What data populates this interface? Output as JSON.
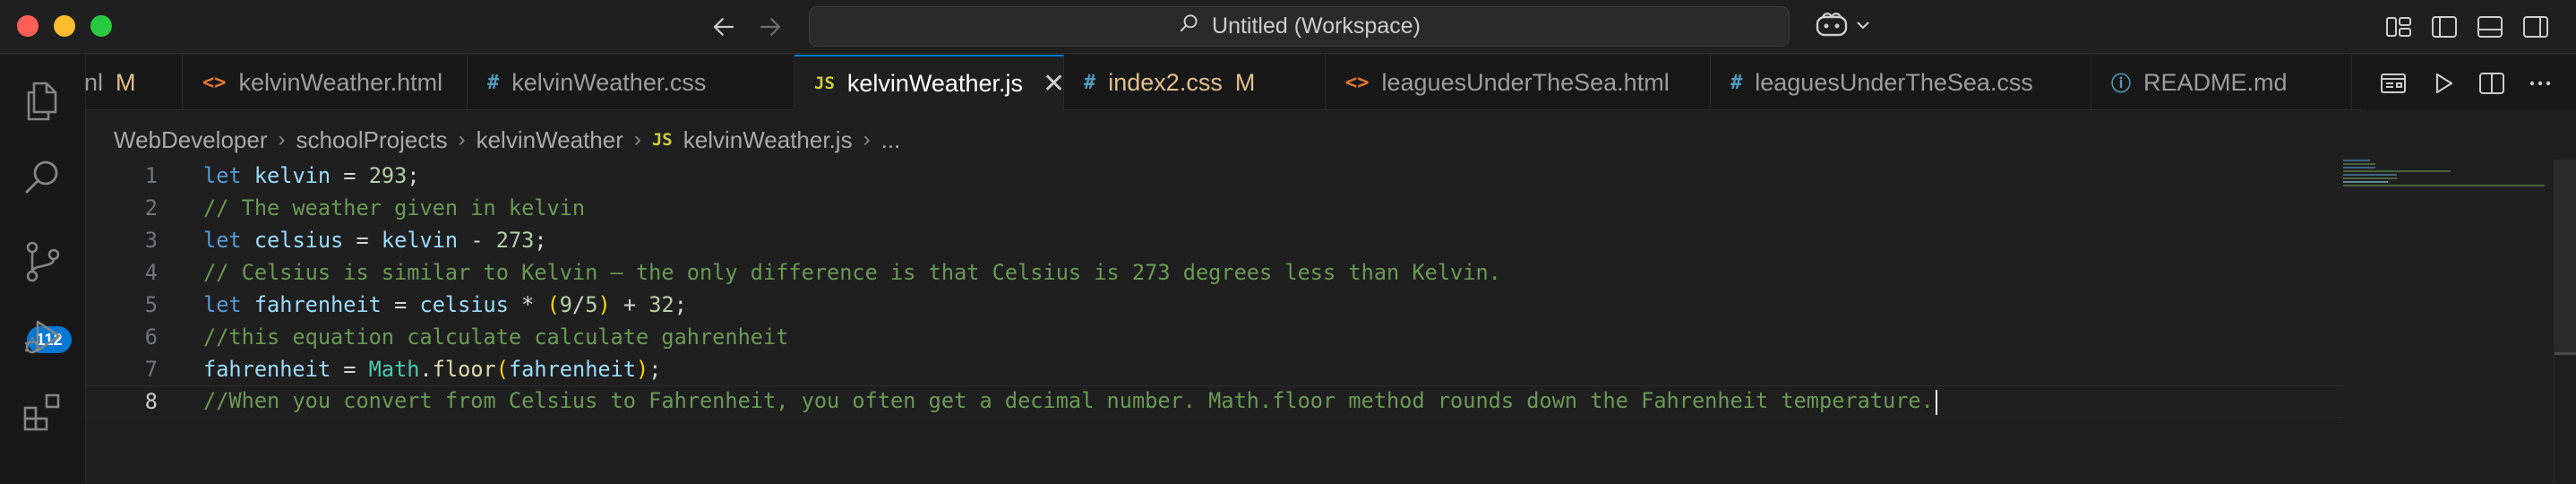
{
  "titlebar": {
    "search_text": "Untitled (Workspace)",
    "icons": [
      "back-arrow-icon",
      "forward-arrow-icon",
      "search-icon",
      "copilot-icon",
      "chevron-down-icon",
      "customize-layout-icon",
      "toggle-primary-sidebar-icon",
      "toggle-panel-icon",
      "toggle-secondary-sidebar-icon"
    ]
  },
  "activitybar": {
    "items": [
      "explorer-icon",
      "search-icon",
      "source-control-icon",
      "run-debug-icon",
      "extensions-icon"
    ],
    "source_control_badge": "112"
  },
  "tabs": [
    {
      "label": "nl",
      "icon": "",
      "modified": "M",
      "active": false
    },
    {
      "label": "kelvinWeather.html",
      "icon": "<>",
      "modified": "",
      "active": false
    },
    {
      "label": "kelvinWeather.css",
      "icon": "#",
      "modified": "",
      "active": false
    },
    {
      "label": "kelvinWeather.js",
      "icon": "JS",
      "modified": "",
      "active": true
    },
    {
      "label": "index2.css",
      "icon": "#",
      "modified": "M",
      "active": false
    },
    {
      "label": "leaguesUnderTheSea.html",
      "icon": "<>",
      "modified": "",
      "active": false
    },
    {
      "label": "leaguesUnderTheSea.css",
      "icon": "#",
      "modified": "",
      "active": false
    },
    {
      "label": "README.md",
      "icon": "ⓘ",
      "modified": "",
      "active": false
    }
  ],
  "tab_actions": [
    "open-preview-icon",
    "run-icon",
    "split-editor-icon",
    "more-actions-icon"
  ],
  "breadcrumb": {
    "items": [
      "WebDeveloper",
      "schoolProjects",
      "kelvinWeather"
    ],
    "file_icon": "JS",
    "file": "kelvinWeather.js",
    "ellipsis": "..."
  },
  "editor": {
    "current_line": 8,
    "line_numbers": [
      "1",
      "2",
      "3",
      "4",
      "5",
      "6",
      "7",
      "8"
    ],
    "lines": {
      "l1": {
        "kw": "let",
        "var": "kelvin",
        "op": " = ",
        "num": "293",
        "end": ";"
      },
      "l2": {
        "comment": "// The weather given in kelvin"
      },
      "l3": {
        "kw": "let",
        "var": "celsius",
        "op": " = ",
        "var2": "kelvin",
        "op2": " - ",
        "num": "273",
        "end": ";"
      },
      "l4": {
        "comment": "// Celsius is similar to Kelvin — the only difference is that Celsius is 273 degrees less than Kelvin."
      },
      "l5": {
        "kw": "let",
        "var": "fahrenheit",
        "op": " = ",
        "var2": "celsius",
        "op2": " * ",
        "p1": "(",
        "num1": "9",
        "slash": "/",
        "num2": "5",
        "p2": ")",
        "op3": " + ",
        "num3": "32",
        "end": ";"
      },
      "l6": {
        "comment": "//this equation calculate calculate gahrenheit"
      },
      "l7": {
        "var": "fahrenheit",
        "op": " = ",
        "obj": "Math",
        "dot": ".",
        "fn": "floor",
        "p1": "(",
        "arg": "fahrenheit",
        "p2": ")",
        "end": ";"
      },
      "l8": {
        "comment": "//When you convert from Celsius to Fahrenheit, you often get a decimal number. Math.floor method rounds down the Fahrenheit temperature."
      }
    }
  }
}
